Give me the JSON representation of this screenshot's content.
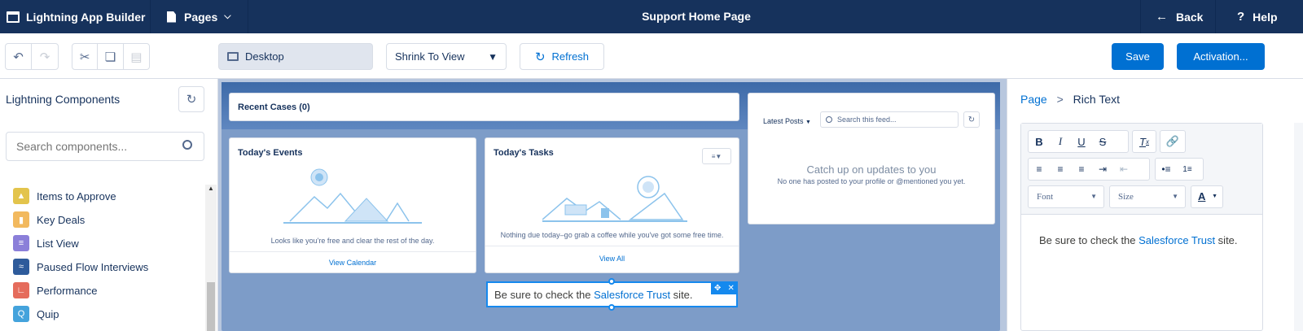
{
  "header": {
    "app_name": "Lightning App Builder",
    "pages_label": "Pages",
    "page_title": "Support Home Page",
    "back_label": "Back",
    "help_label": "Help"
  },
  "toolbar": {
    "device": "Desktop",
    "zoom": "Shrink To View",
    "refresh": "Refresh",
    "save": "Save",
    "activation": "Activation..."
  },
  "left_panel": {
    "title": "Lightning Components",
    "search_placeholder": "Search components...",
    "components": [
      {
        "label": "Items to Approve",
        "color": "#e3c44c",
        "icon": "approve-icon"
      },
      {
        "label": "Key Deals",
        "color": "#f2b95e",
        "icon": "bar-chart-icon"
      },
      {
        "label": "List View",
        "color": "#8b7fd9",
        "icon": "list-icon"
      },
      {
        "label": "Paused Flow Interviews",
        "color": "#2e5b9b",
        "icon": "flow-icon"
      },
      {
        "label": "Performance",
        "color": "#e56c5c",
        "icon": "chart-icon"
      },
      {
        "label": "Quip",
        "color": "#44a3dc",
        "icon": "quip-icon"
      }
    ]
  },
  "canvas": {
    "recent_cases": "Recent Cases (0)",
    "events": {
      "title": "Today's Events",
      "message": "Looks like you're free and clear the rest of the day.",
      "link": "View Calendar"
    },
    "tasks": {
      "title": "Today's Tasks",
      "message": "Nothing due today–go grab a coffee while you've got some free time.",
      "link": "View All"
    },
    "feed": {
      "latest_posts": "Latest Posts",
      "search_placeholder": "Search this feed...",
      "empty_title": "Catch up on updates to you",
      "empty_sub": "No one has posted to your profile or @mentioned you yet."
    },
    "rich_text": {
      "before": "Be sure to check the ",
      "link": "Salesforce Trust",
      "after": " site."
    }
  },
  "right_panel": {
    "breadcrumb_root": "Page",
    "breadcrumb_sep": ">",
    "breadcrumb_current": "Rich Text",
    "font_label": "Font",
    "size_label": "Size",
    "editor_before": "Be sure to check the ",
    "editor_link": "Salesforce Trust",
    "editor_after": " site."
  },
  "colors": {
    "header_bg": "#16325c",
    "brand": "#0070d2",
    "canvas_bg": "#b8c7de",
    "link": "#0070d2"
  }
}
